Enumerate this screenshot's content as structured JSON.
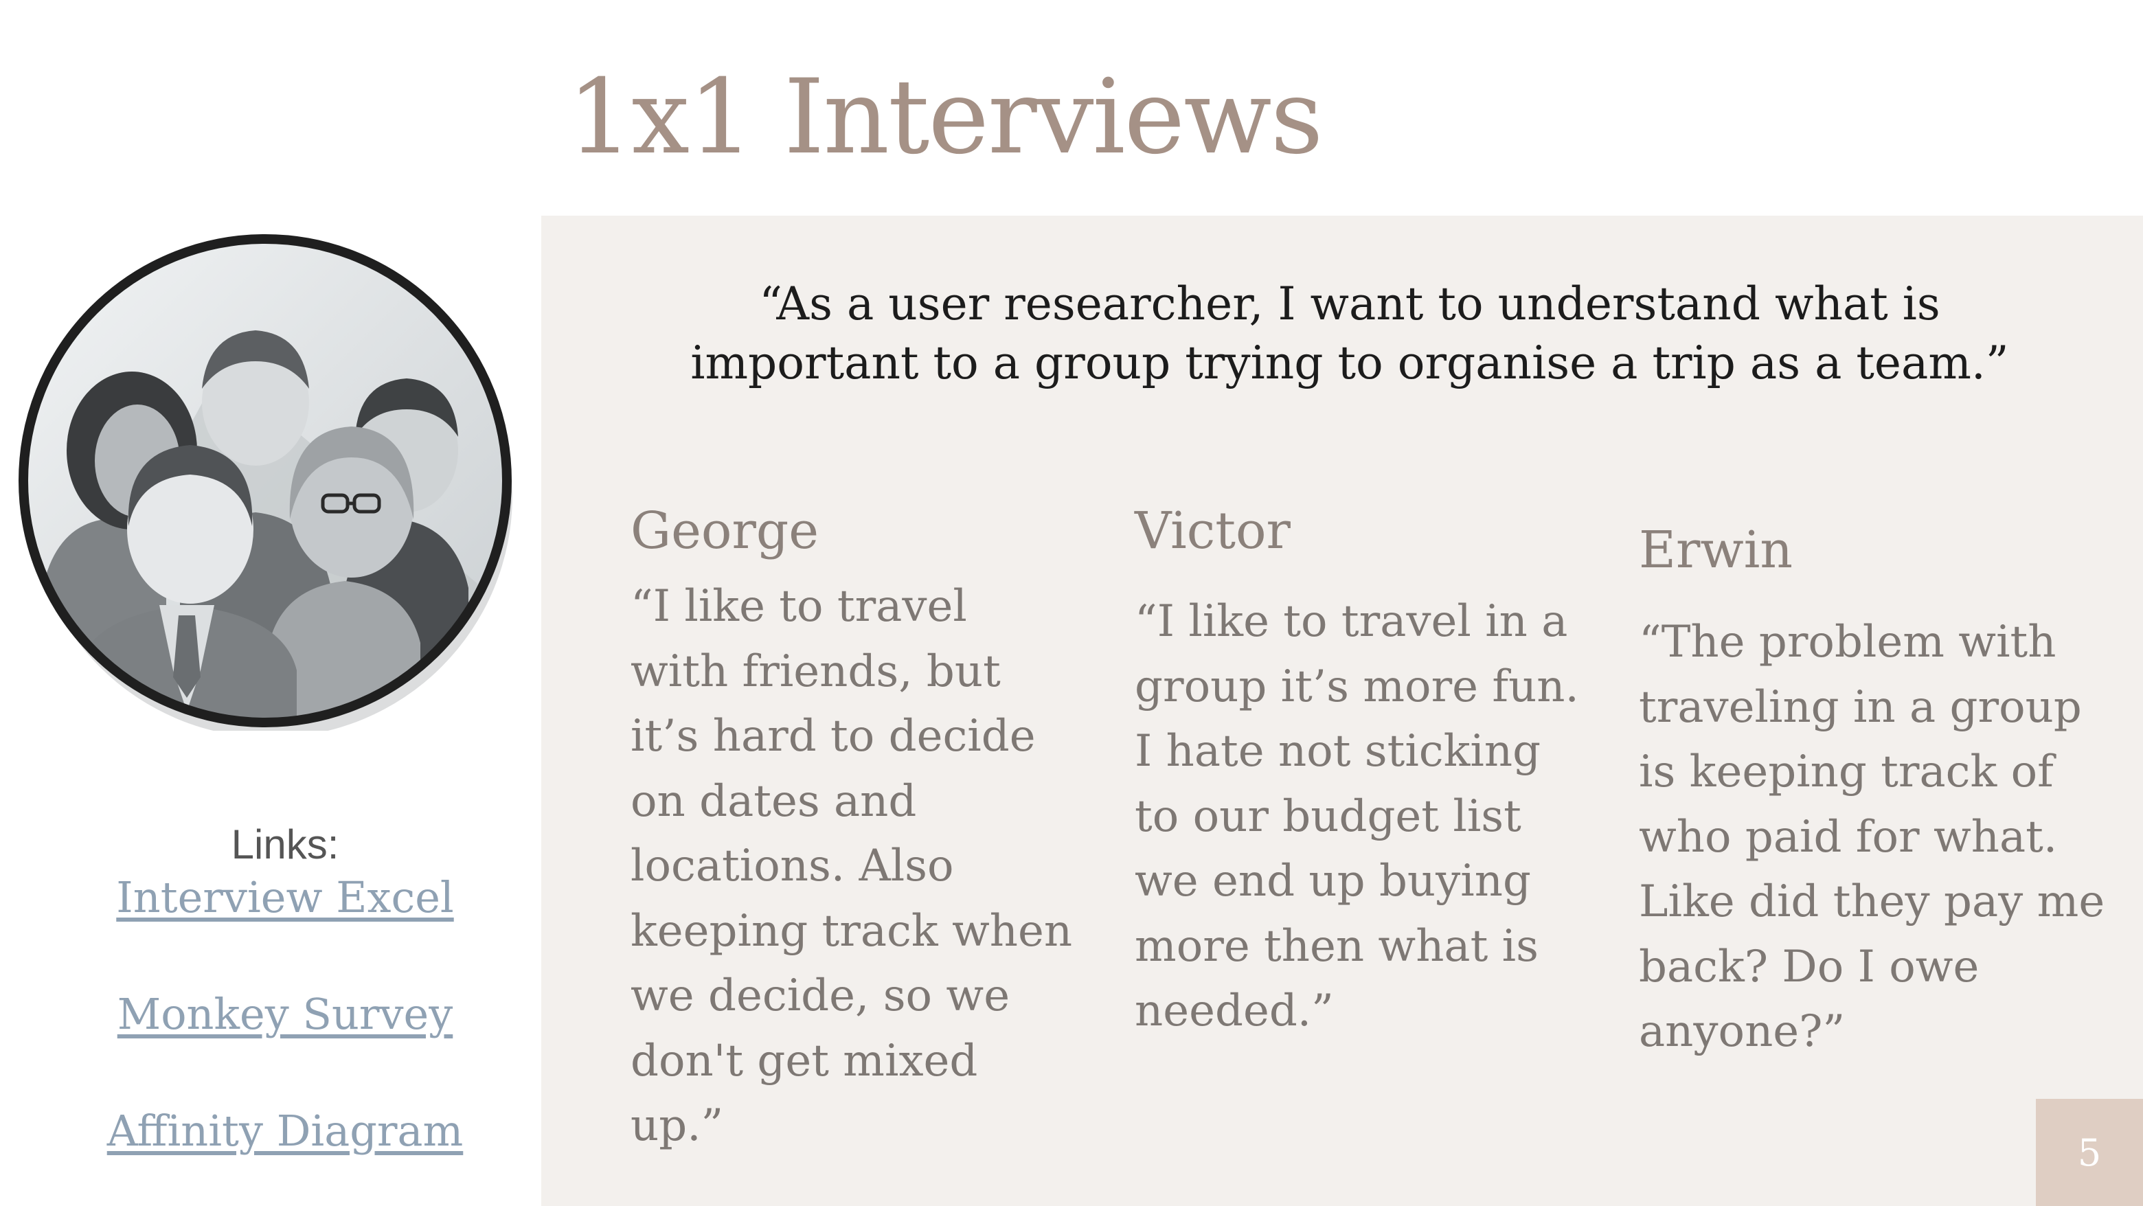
{
  "slide": {
    "title": "1x1 Interviews",
    "page_number": "5",
    "colors": {
      "title": "#a59186",
      "panel": "#f3f0ed",
      "link": "#8fa1b3",
      "page_badge": "#dfcec3"
    }
  },
  "quote": "“As a user researcher, I want to understand what is important to a group trying to organise a trip as a team.”",
  "personas": [
    {
      "name": "George",
      "text": "“I like to travel with friends, but it’s hard to decide on dates and locations. Also keeping track when we decide, so we don't get mixed up.”"
    },
    {
      "name": "Victor",
      "text": "“I like to travel in a group it’s more fun. I hate not sticking to our budget list we end up buying more then what is needed.”"
    },
    {
      "name": "Erwin",
      "text": "“The problem with traveling in a group is keeping track of who paid for what. Like did they pay me back? Do I owe anyone?”"
    }
  ],
  "links": {
    "label": "Links:",
    "items": [
      "Interview Excel",
      "Monkey Survey",
      "Affinity Diagram"
    ]
  },
  "image": {
    "icon": "group-of-people-icon"
  }
}
